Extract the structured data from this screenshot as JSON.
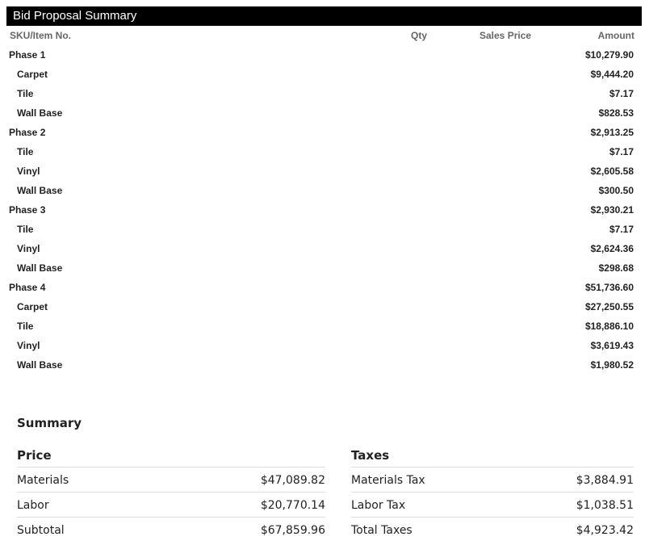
{
  "title": "Bid Proposal Summary",
  "columns": {
    "sku": "SKU/Item No.",
    "qty": "Qty",
    "sales_price": "Sales Price",
    "amount": "Amount"
  },
  "rows": [
    {
      "name": "Phase 1",
      "amount": "$10,279.90",
      "level": "phase"
    },
    {
      "name": "Carpet",
      "amount": "$9,444.20",
      "level": "item"
    },
    {
      "name": "Tile",
      "amount": "$7.17",
      "level": "item"
    },
    {
      "name": "Wall Base",
      "amount": "$828.53",
      "level": "item"
    },
    {
      "name": "Phase 2",
      "amount": "$2,913.25",
      "level": "phase"
    },
    {
      "name": "Tile",
      "amount": "$7.17",
      "level": "item"
    },
    {
      "name": "Vinyl",
      "amount": "$2,605.58",
      "level": "item"
    },
    {
      "name": "Wall Base",
      "amount": "$300.50",
      "level": "item"
    },
    {
      "name": "Phase 3",
      "amount": "$2,930.21",
      "level": "phase"
    },
    {
      "name": "Tile",
      "amount": "$7.17",
      "level": "item"
    },
    {
      "name": "Vinyl",
      "amount": "$2,624.36",
      "level": "item"
    },
    {
      "name": "Wall Base",
      "amount": "$298.68",
      "level": "item"
    },
    {
      "name": "Phase 4",
      "amount": "$51,736.60",
      "level": "phase"
    },
    {
      "name": "Carpet",
      "amount": "$27,250.55",
      "level": "item"
    },
    {
      "name": "Tile",
      "amount": "$18,886.10",
      "level": "item"
    },
    {
      "name": "Vinyl",
      "amount": "$3,619.43",
      "level": "item"
    },
    {
      "name": "Wall Base",
      "amount": "$1,980.52",
      "level": "item"
    }
  ],
  "summary": {
    "title": "Summary",
    "price": {
      "heading": "Price",
      "rows": [
        {
          "label": "Materials",
          "value": "$47,089.82"
        },
        {
          "label": "Labor",
          "value": "$20,770.14"
        },
        {
          "label": "Subtotal",
          "value": "$67,859.96"
        }
      ]
    },
    "taxes": {
      "heading": "Taxes",
      "rows": [
        {
          "label": "Materials Tax",
          "value": "$3,884.91"
        },
        {
          "label": "Labor Tax",
          "value": "$1,038.51"
        },
        {
          "label": "Total Taxes",
          "value": "$4,923.42"
        }
      ]
    }
  }
}
